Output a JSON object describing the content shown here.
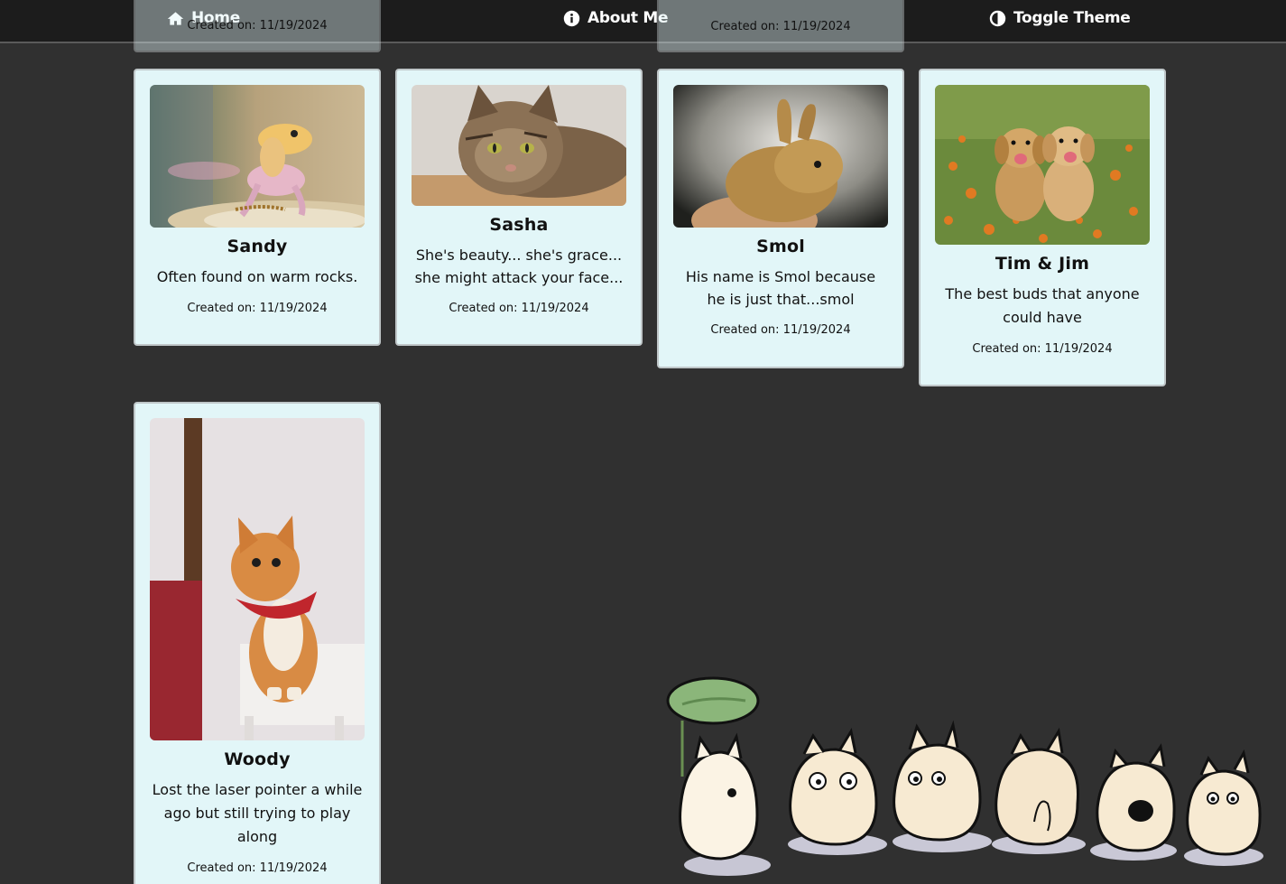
{
  "nav": {
    "home_label": "Home",
    "about_label": "About Me",
    "theme_label": "Toggle Theme"
  },
  "peek_cards": [
    {
      "date": "Created on: 11/19/2024"
    },
    {
      "date": "Created on: 11/19/2024"
    }
  ],
  "cards": [
    {
      "title": "Sandy",
      "description": "Often found on warm rocks.",
      "date": "Created on: 11/19/2024",
      "image": "gecko"
    },
    {
      "title": "Sasha",
      "description": "She's beauty... she's grace... she might attack your face...",
      "date": "Created on: 11/19/2024",
      "image": "tabby-cat"
    },
    {
      "title": "Smol",
      "description": "His name is Smol because he is just that...smol",
      "date": "Created on: 11/19/2024",
      "image": "bunny"
    },
    {
      "title": "Tim & Jim",
      "description": "The best buds that anyone could have",
      "date": "Created on: 11/19/2024",
      "image": "puppies"
    },
    {
      "title": "Woody",
      "description": "Lost the laser pointer a while ago but still trying to play along",
      "date": "Created on: 11/19/2024",
      "image": "orange-cat"
    }
  ],
  "colors": {
    "background": "#303030",
    "navbar": "#1c1c1c",
    "card": "#e2f6f8"
  }
}
